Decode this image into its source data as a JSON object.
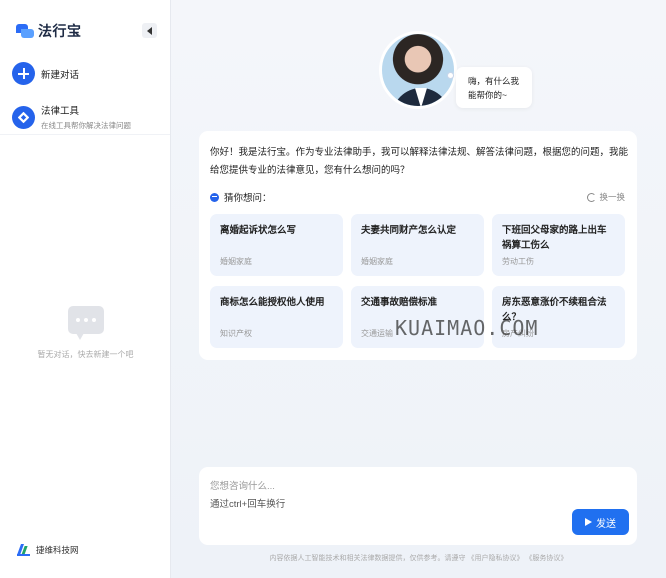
{
  "sidebar": {
    "logo_text": "法行宝",
    "new_chat_label": "新建对话",
    "tools_label": "法律工具",
    "tools_sub": "在线工具帮你解决法律问题",
    "empty_text": "暂无对话，快去新建一个吧",
    "brand_text": "捷维科技网"
  },
  "main": {
    "greeting": "嗨，有什么我能帮你的~",
    "intro": "你好！我是法行宝。作为专业法律助手，我可以解释法律法规、解答法律问题，根据您的问题，我能给您提供专业的法律意见，您有什么想问的吗？",
    "guess_label": "猜你想问：",
    "refresh_label": "换一换",
    "questions": [
      {
        "title": "离婚起诉状怎么写",
        "tag": "婚姻家庭"
      },
      {
        "title": "夫妻共同财产怎么认定",
        "tag": "婚姻家庭"
      },
      {
        "title": "下班回父母家的路上出车祸算工伤么",
        "tag": "劳动工伤"
      },
      {
        "title": "商标怎么能授权他人使用",
        "tag": "知识产权"
      },
      {
        "title": "交通事故赔偿标准",
        "tag": "交通运输"
      },
      {
        "title": "房东恶意涨价不续租合法么？",
        "tag": "房产纠纷"
      }
    ],
    "input_placeholder": "您想咨询什么...",
    "input_hint": "通过ctrl+回车换行",
    "send_label": "发送",
    "disclaimer": "内容依据人工智能技术和相关法律数据提供，仅供参考。请遵守 《用户隐私协议》 《服务协议》"
  },
  "watermark": "KUAIMAO.COM",
  "colors": {
    "accent": "#2070f0",
    "card_bg": "#eef3fc"
  }
}
